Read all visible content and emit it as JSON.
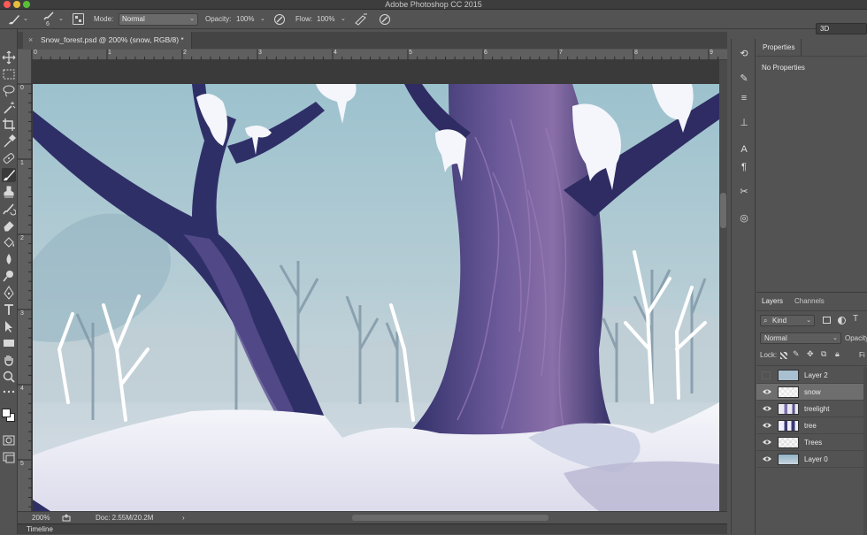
{
  "app": {
    "title": "Adobe Photoshop CC 2015",
    "workspace": "3D"
  },
  "options_bar": {
    "brush_size": "6",
    "mode_label": "Mode:",
    "mode_value": "Normal",
    "opacity_label": "Opacity:",
    "opacity_value": "100%",
    "flow_label": "Flow:",
    "flow_value": "100%"
  },
  "document": {
    "tab_title": "Snow_forest.psd @ 200% (snow, RGB/8) *",
    "tab_close": "×",
    "ruler_top_marks": [
      "0",
      "1",
      "2",
      "3",
      "4",
      "5",
      "6",
      "7",
      "8",
      "9"
    ],
    "ruler_left_marks": [
      "0",
      "1",
      "2",
      "3",
      "4",
      "5"
    ]
  },
  "status_bar": {
    "zoom": "200%",
    "doc_info": "Doc: 2.55M/20.2M",
    "arrow": "›"
  },
  "timeline": {
    "label": "Timeline"
  },
  "properties": {
    "tab": "Properties",
    "empty_text": "No Properties"
  },
  "layers": {
    "tabs": [
      "Layers",
      "Channels"
    ],
    "filter_kind": "Kind",
    "blend_mode": "Normal",
    "opacity_label": "Opacity",
    "lock_label": "Lock:",
    "fill_label": "Fi",
    "items": [
      {
        "name": "Layer 2",
        "visible": false,
        "selected": false,
        "thumb": "#a8c0d0"
      },
      {
        "name": "snow",
        "visible": true,
        "selected": true,
        "thumb": "#e6e6e6"
      },
      {
        "name": "treelight",
        "visible": true,
        "selected": false,
        "thumb": "#bcb6d6"
      },
      {
        "name": "tree",
        "visible": true,
        "selected": false,
        "thumb": "#cfcfdf"
      },
      {
        "name": "Trees",
        "visible": true,
        "selected": false,
        "thumb": "#e4e4e4"
      },
      {
        "name": "Layer 0",
        "visible": true,
        "selected": false,
        "thumb": "#9fbcd0"
      }
    ]
  },
  "colors": {
    "foreground": "#ffffff",
    "background": "#ffffff",
    "sky": "#9dbfcc",
    "trunk": "#3d3a78",
    "snow": "#f3f3fa"
  },
  "icons": {
    "toolbar": [
      "move-icon",
      "marquee-icon",
      "lasso-icon",
      "magic-wand-icon",
      "crop-icon",
      "eyedropper-icon",
      "healing-brush-icon",
      "brush-icon",
      "clone-stamp-icon",
      "history-brush-icon",
      "eraser-icon",
      "paint-bucket-icon",
      "blur-icon",
      "dodge-icon",
      "pen-icon",
      "type-icon",
      "path-selection-icon",
      "rectangle-icon",
      "hand-icon",
      "zoom-icon"
    ],
    "strip": [
      "history-icon",
      "brush-preset-icon",
      "adjustments-icon",
      "clone-source-icon",
      "character-icon",
      "paragraph-icon",
      "tool-presets-icon",
      "libraries-icon"
    ]
  }
}
